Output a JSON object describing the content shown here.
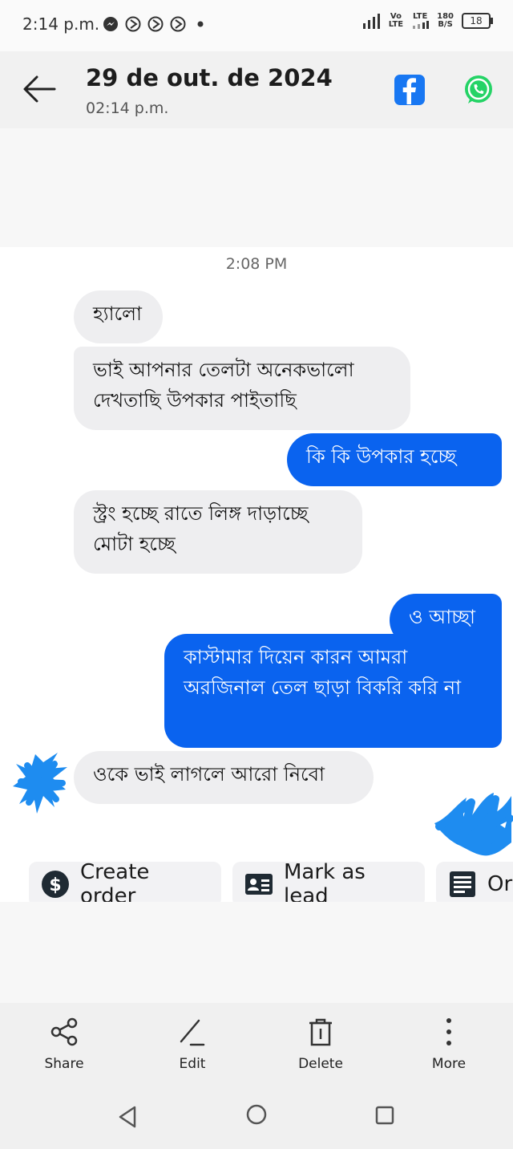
{
  "status_bar": {
    "time": "2:14 p.m.",
    "network_top": "Vo",
    "network_bottom": "LTE",
    "lte_label": "LTE",
    "speed_value": "180",
    "speed_unit": "B/S",
    "battery": "18"
  },
  "header": {
    "title": "29 de out. de 2024",
    "subtitle": "02:14 p.m.",
    "icons": [
      "back-arrow-icon",
      "facebook-icon",
      "whatsapp-icon"
    ]
  },
  "chat": {
    "day_time": "2:08 PM",
    "messages": [
      {
        "direction": "in",
        "text": "হ্যালো"
      },
      {
        "direction": "in",
        "text": "ভাই আপনার তেলটা অনেকভালো দেখতাছি উপকার পাইতাছি"
      },
      {
        "direction": "out",
        "text": "কি কি উপকার হচ্ছে"
      },
      {
        "direction": "in",
        "text": "স্ট্রং হচ্ছে রাতে লিঙ্গ দাড়াচ্ছে মোটা হচ্ছে"
      },
      {
        "direction": "out",
        "text": "ও আচ্ছা"
      },
      {
        "direction": "out",
        "text": "কাস্টামার দিয়েন কারন আমরা অরজিনাল তেল ছাড়া বিকরি করি না"
      },
      {
        "direction": "in",
        "text": "ওকে ভাই লাগলে আরো নিবো"
      }
    ]
  },
  "actions": {
    "create_order": "Create order",
    "mark_as_lead": "Mark as lead",
    "third_partial": "Or"
  },
  "toolbar": {
    "share": "Share",
    "edit": "Edit",
    "delete": "Delete",
    "more": "More"
  },
  "colors": {
    "outgoing_bubble": "#0a63ef",
    "incoming_bubble": "#eeeef0",
    "scribble": "#1e8cf0"
  }
}
